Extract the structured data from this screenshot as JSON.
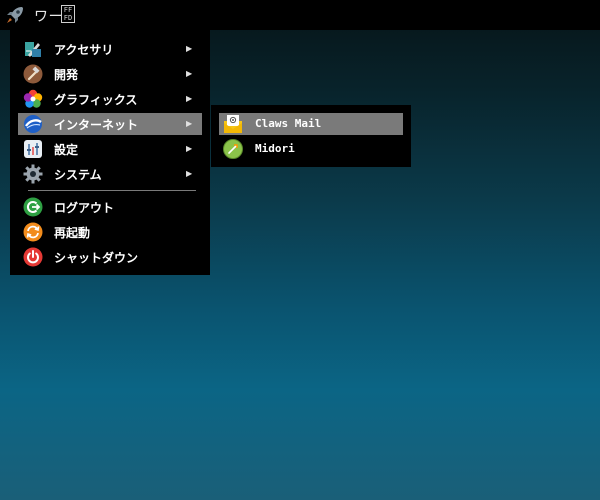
{
  "panel": {
    "workspace_label": "ワー",
    "hex_glyph_top": "FF",
    "hex_glyph_bottom": "FD",
    "launcher_icon": "rocket-icon"
  },
  "menu": {
    "items": [
      {
        "label": "アクセサリ",
        "icon": "accessories-icon",
        "arrow": "▶"
      },
      {
        "label": "開発",
        "icon": "development-hammer-icon",
        "arrow": "▶"
      },
      {
        "label": "グラフィックス",
        "icon": "graphics-flower-icon",
        "arrow": "▶"
      },
      {
        "label": "インターネット",
        "icon": "internet-globe-icon",
        "arrow": "▶"
      },
      {
        "label": "設定",
        "icon": "settings-icon",
        "arrow": "▶"
      },
      {
        "label": "システム",
        "icon": "system-gear-icon",
        "arrow": "▶"
      },
      {
        "label": "ログアウト",
        "icon": "logout-icon"
      },
      {
        "label": "再起動",
        "icon": "reboot-icon"
      },
      {
        "label": "シャットダウン",
        "icon": "shutdown-icon"
      }
    ]
  },
  "submenu": {
    "items": [
      {
        "label": "Claws Mail",
        "icon": "mail-envelope-icon"
      },
      {
        "label": "Midori",
        "icon": "midori-browser-icon"
      }
    ]
  },
  "colors": {
    "highlight": "#7a7a7a",
    "menu_bg": "#000000",
    "logout_green": "#2ea043",
    "reboot_orange": "#f28c1c",
    "shutdown_red": "#e53935"
  }
}
